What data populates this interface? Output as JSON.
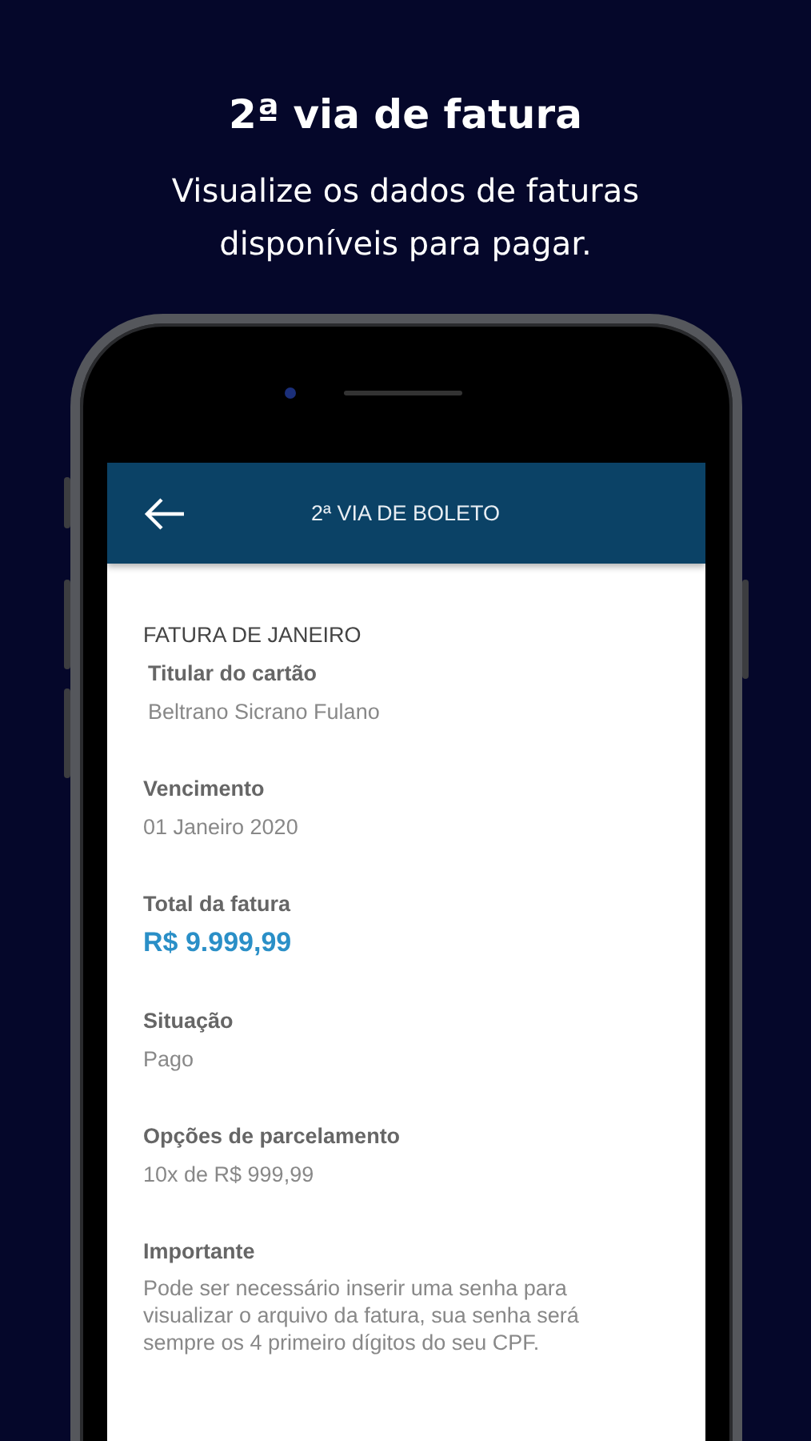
{
  "headline": {
    "title": "2ª via de fatura",
    "subtitle": "Visualize os dados de faturas disponíveis para pagar."
  },
  "app_bar": {
    "title": "2ª VIA DE BOLETO"
  },
  "invoice": {
    "title": "FATURA DE JANEIRO",
    "fields": [
      {
        "kind": "text",
        "label": "Titular do cartão",
        "value": "Beltrano Sicrano Fulano"
      },
      {
        "kind": "text",
        "label": "Vencimento",
        "value": "01 Janeiro 2020"
      },
      {
        "kind": "amount",
        "label": "Total da fatura",
        "value": "R$ 9.999,99"
      },
      {
        "kind": "text",
        "label": "Situação",
        "value": "Pago"
      },
      {
        "kind": "text",
        "label": "Opções de parcelamento",
        "value": "10x de R$ 999,99"
      },
      {
        "kind": "note",
        "label": "Importante",
        "value": "Pode ser necessário inserir uma senha para visualizar o arquivo da fatura, sua senha será sempre os 4 primeiro dígitos do seu CPF."
      }
    ]
  }
}
